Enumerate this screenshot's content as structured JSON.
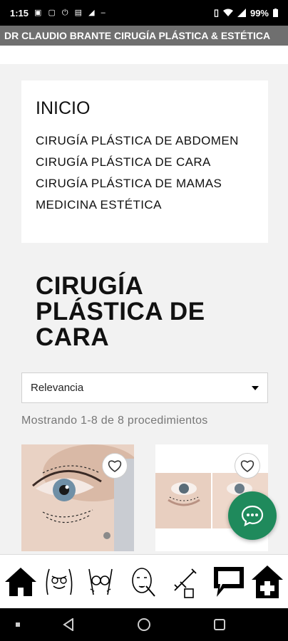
{
  "status_bar": {
    "time": "1:15",
    "battery": "99%",
    "left_icons": [
      "photo-icon",
      "lock-icon",
      "power-icon",
      "sim-icon",
      "signal-text-icon",
      "dash-icon"
    ],
    "right_icons": [
      "vibrate-icon",
      "wifi-icon",
      "signal-icon",
      "battery-icon"
    ]
  },
  "app_title": "DR CLAUDIO BRANTE CIRUGÍA PLÁSTICA & ESTÉTICA",
  "menu": {
    "title": "INICIO",
    "items": [
      "CIRUGÍA PLÁSTICA DE ABDOMEN",
      "CIRUGÍA PLÁSTICA DE CARA",
      "CIRUGÍA PLÁSTICA DE MAMAS",
      "MEDICINA ESTÉTICA"
    ]
  },
  "page_title": "CIRUGÍA PLÁSTICA DE CARA",
  "sort": {
    "selected": "Relevancia"
  },
  "results_text": "Mostrando 1-8 de 8 procedimientos",
  "products": [
    {
      "image": "eye-surgery-markings-photo",
      "icon": "heart-icon"
    },
    {
      "image": "eyes-before-after-photo",
      "icon": "heart-icon"
    }
  ],
  "chat_fab": {
    "icon": "chat-bubble-icon",
    "color": "#1f8a5c"
  },
  "bottom_nav": [
    "home-icon",
    "abdomen-icon",
    "breast-icon",
    "face-icon",
    "syringe-icon",
    "chat-icon",
    "clinic-icon"
  ],
  "system_nav": [
    "back-icon",
    "home-circle-icon",
    "recents-icon"
  ]
}
